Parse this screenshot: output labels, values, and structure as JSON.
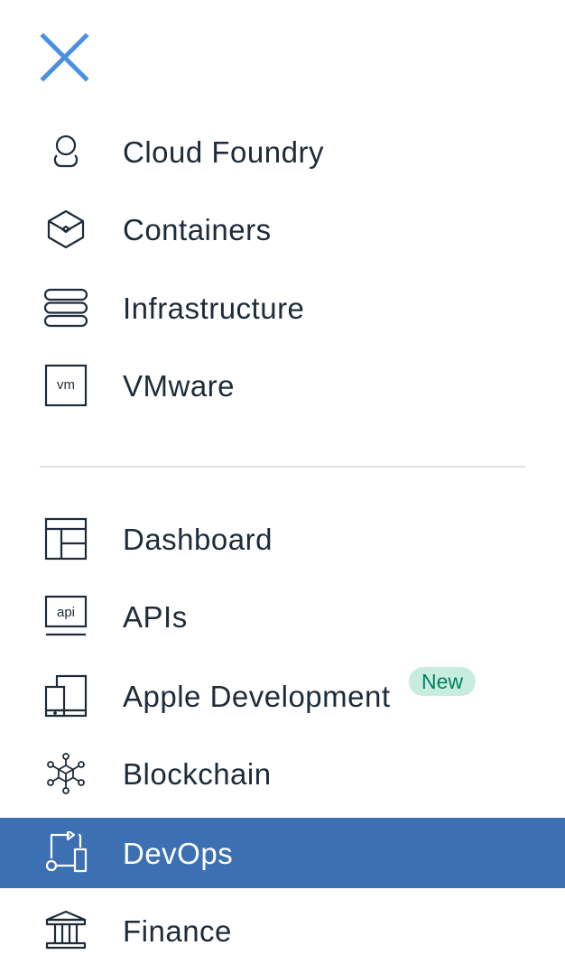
{
  "close": {
    "icon": "close-icon",
    "color": "#4a90e2"
  },
  "groups": [
    {
      "items": [
        {
          "label": "Cloud Foundry",
          "icon": "cloud-foundry-icon"
        },
        {
          "label": "Containers",
          "icon": "containers-icon"
        },
        {
          "label": "Infrastructure",
          "icon": "infrastructure-icon"
        },
        {
          "label": "VMware",
          "icon": "vmware-icon",
          "icon_text": "vm"
        }
      ]
    },
    {
      "items": [
        {
          "label": "Dashboard",
          "icon": "dashboard-icon"
        },
        {
          "label": "APIs",
          "icon": "api-icon",
          "icon_text": "api"
        },
        {
          "label": "Apple Development",
          "icon": "apple-development-icon",
          "badge": "New"
        },
        {
          "label": "Blockchain",
          "icon": "blockchain-icon"
        },
        {
          "label": "DevOps",
          "icon": "devops-icon",
          "active": true
        },
        {
          "label": "Finance",
          "icon": "finance-icon"
        }
      ]
    }
  ],
  "colors": {
    "active_background": "#3d70b2",
    "text": "#1d2b3a",
    "badge_background": "#c8eddf",
    "badge_text": "#007f62",
    "divider": "#dfe3e6"
  }
}
